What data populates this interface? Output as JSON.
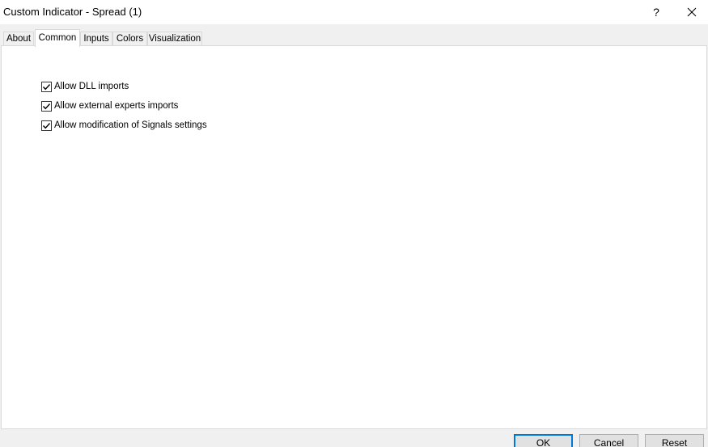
{
  "window": {
    "title": "Custom Indicator - Spread (1)",
    "help_label": "?"
  },
  "tabs": [
    {
      "label": "About",
      "active": false
    },
    {
      "label": "Common",
      "active": true
    },
    {
      "label": "Inputs",
      "active": false
    },
    {
      "label": "Colors",
      "active": false
    },
    {
      "label": "Visualization",
      "active": false
    }
  ],
  "options": [
    {
      "label": "Allow DLL imports",
      "checked": true
    },
    {
      "label": "Allow external experts imports",
      "checked": true
    },
    {
      "label": "Allow modification of Signals settings",
      "checked": true
    }
  ],
  "buttons": {
    "ok": "OK",
    "cancel": "Cancel",
    "reset": "Reset"
  },
  "colors": {
    "accent": "#0078d7",
    "panel": "#ffffff",
    "chrome": "#f0f0f0"
  }
}
